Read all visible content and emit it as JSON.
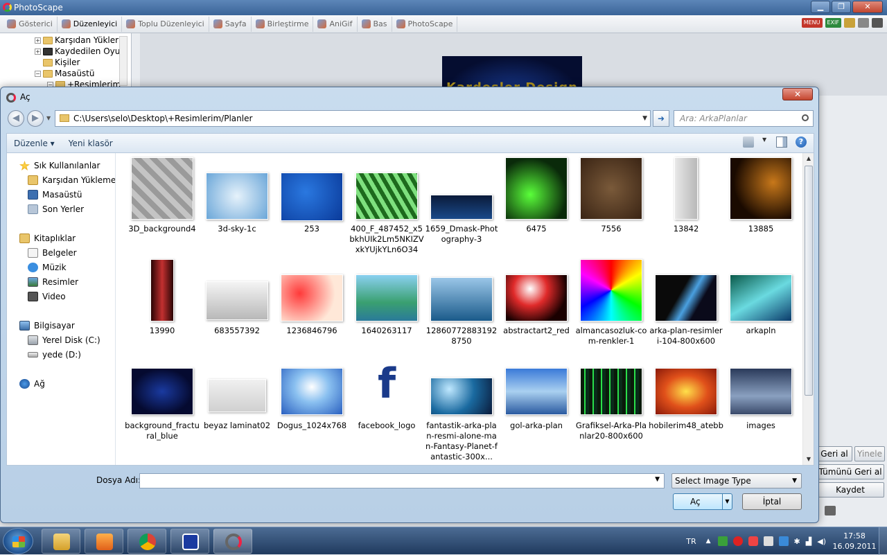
{
  "app": {
    "title": "PhotoScape",
    "tabs": [
      {
        "label": "Gösterici",
        "active": false
      },
      {
        "label": "Düzenleyici",
        "active": true
      },
      {
        "label": "Toplu Düzenleyici",
        "active": false
      },
      {
        "label": "Sayfa",
        "active": false
      },
      {
        "label": "Birleştirme",
        "active": false
      },
      {
        "label": "AniGif",
        "active": false
      },
      {
        "label": "Bas",
        "active": false
      },
      {
        "label": "PhotoScape",
        "active": false
      }
    ],
    "tools": {
      "menu": "MENU",
      "exif": "EXIF"
    },
    "tree": [
      {
        "label": "Karşıdan Yükler"
      },
      {
        "label": "Kaydedilen Oyu"
      },
      {
        "label": "Kişiler"
      },
      {
        "label": "Masaüstü"
      },
      {
        "label": "+Resimlerim"
      }
    ],
    "preview_text": "Kardeşler Design",
    "right_buttons": {
      "undo": "Geri al",
      "redo": "Yinele",
      "undo_all": "Tümünü Geri al",
      "save": "Kaydet"
    }
  },
  "dialog": {
    "title": "Aç",
    "address": "C:\\Users\\selo\\Desktop\\+Resimlerim/Planler",
    "search_placeholder": "Ara: ArkaPlanlar",
    "toolbar": {
      "organize": "Düzenle",
      "new_folder": "Yeni klasör"
    },
    "nav": {
      "favorites": "Sık Kullanılanlar",
      "downloads": "Karşıdan Yüklemele",
      "desktop": "Masaüstü",
      "recent": "Son Yerler",
      "libraries": "Kitaplıklar",
      "documents": "Belgeler",
      "music": "Müzik",
      "pictures": "Resimler",
      "video": "Video",
      "computer": "Bilgisayar",
      "local_disk": "Yerel Disk (C:)",
      "drive_d": "yede (D:)",
      "network": "Ağ"
    },
    "files": [
      {
        "name": "3D_background4"
      },
      {
        "name": "3d-sky-1c"
      },
      {
        "name": "253"
      },
      {
        "name": "400_F_487452_x5bkhUIk2Lm5NKIZVxkYUjkYLn6O34"
      },
      {
        "name": "1659_Dmask-Photography-3"
      },
      {
        "name": "6475"
      },
      {
        "name": "7556"
      },
      {
        "name": "13842"
      },
      {
        "name": "13885"
      },
      {
        "name": "13990"
      },
      {
        "name": "683557392"
      },
      {
        "name": "1236846796"
      },
      {
        "name": "1640263117"
      },
      {
        "name": "128607728831928750"
      },
      {
        "name": "abstractart2_red"
      },
      {
        "name": "almancasozluk-com-renkler-1"
      },
      {
        "name": "arka-plan-resimleri-104-800x600"
      },
      {
        "name": "arkapln"
      },
      {
        "name": "background_fractural_blue"
      },
      {
        "name": "beyaz laminat02"
      },
      {
        "name": "Dogus_1024x768"
      },
      {
        "name": "facebook_logo"
      },
      {
        "name": "fantastik-arka-plan-resmi-alone-man-Fantasy-Planet-fantastic-300x..."
      },
      {
        "name": "gol-arka-plan"
      },
      {
        "name": "Grafiksel-Arka-Planlar20-800x600"
      },
      {
        "name": "hobilerim48_atebb"
      },
      {
        "name": "images"
      }
    ],
    "filename_label": "Dosya Adı:",
    "filename_value": "",
    "filetype": "Select Image Type",
    "open_button": "Aç",
    "cancel_button": "İptal"
  },
  "taskbar": {
    "language": "TR",
    "time": "17:58",
    "date": "16.09.2011"
  }
}
